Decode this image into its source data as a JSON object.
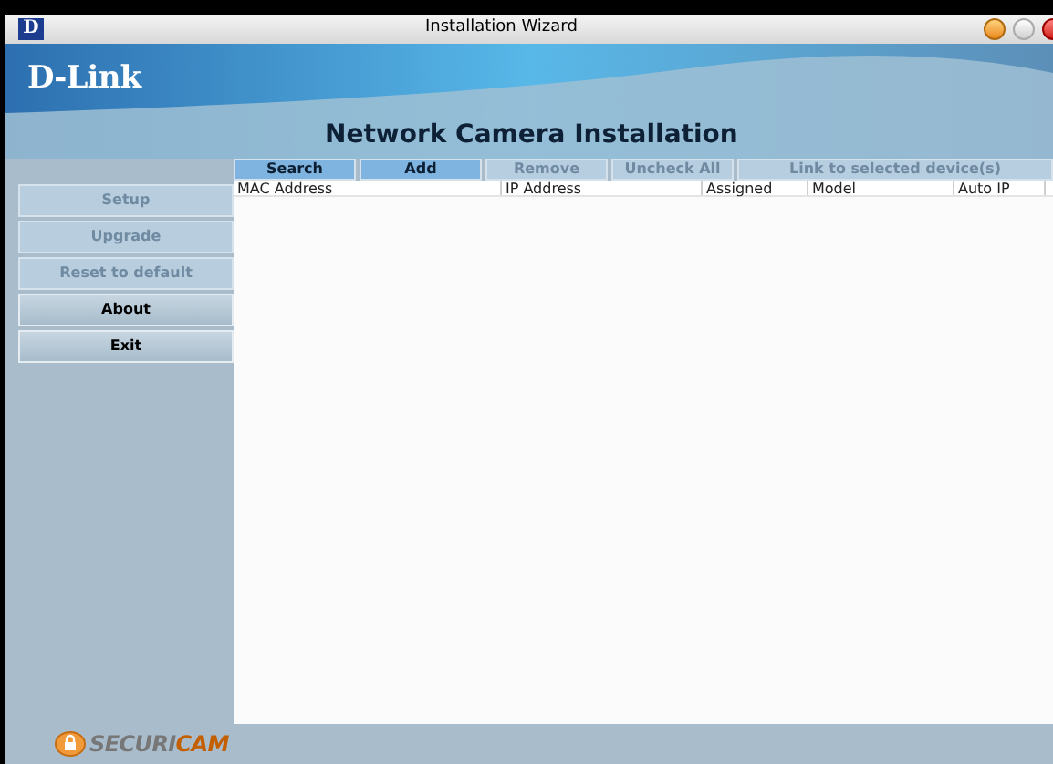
{
  "window": {
    "title": "Installation Wizard",
    "app_icon": "D"
  },
  "header": {
    "brand": "D-Link",
    "title": "Network Camera Installation"
  },
  "toolbar": [
    {
      "label": "Search",
      "disabled": false
    },
    {
      "label": "Add",
      "disabled": false
    },
    {
      "label": "Remove",
      "disabled": true
    },
    {
      "label": "Uncheck All",
      "disabled": true
    },
    {
      "label": "Link to selected device(s)",
      "disabled": true
    }
  ],
  "sidebar": {
    "items": [
      {
        "label": "Setup",
        "disabled": true
      },
      {
        "label": "Upgrade",
        "disabled": true
      },
      {
        "label": "Reset to default",
        "disabled": true
      },
      {
        "label": "About",
        "disabled": false
      },
      {
        "label": "Exit",
        "disabled": false
      }
    ]
  },
  "table": {
    "columns": [
      "MAC Address",
      "IP Address",
      "Assigned",
      "Model",
      "Auto IP"
    ]
  },
  "footer": {
    "logo": [
      {
        "text": "SECURI",
        "kind": "plain"
      },
      {
        "text": "CAM",
        "kind": "accent"
      }
    ]
  }
}
